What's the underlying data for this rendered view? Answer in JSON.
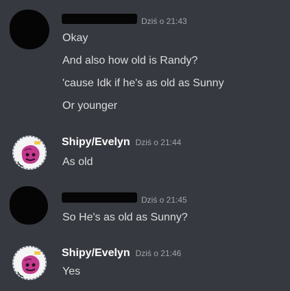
{
  "messages": [
    {
      "author": "",
      "author_redacted": true,
      "timestamp": "Dziś o 21:43",
      "lines": [
        "Okay",
        "And also how old is Randy?",
        "'cause Idk if he's as old as Sunny",
        "Or younger"
      ]
    },
    {
      "author": "Shipy/Evelyn",
      "author_redacted": false,
      "timestamp": "Dziś o 21:44",
      "lines": [
        "As old"
      ]
    },
    {
      "author": "",
      "author_redacted": true,
      "timestamp": "Dziś o 21:45",
      "lines": [
        "So He's as old as Sunny?"
      ]
    },
    {
      "author": "Shipy/Evelyn",
      "author_redacted": false,
      "timestamp": "Dziś o 21:46",
      "lines": [
        "Yes"
      ]
    }
  ],
  "colors": {
    "background": "#36393f",
    "username": "#ffffff",
    "message_text": "#dcddde",
    "timestamp": "#a3a6aa",
    "redaction": "#050505"
  },
  "icons": {
    "avatar_shipy": "pink-character-avatar-icon"
  }
}
